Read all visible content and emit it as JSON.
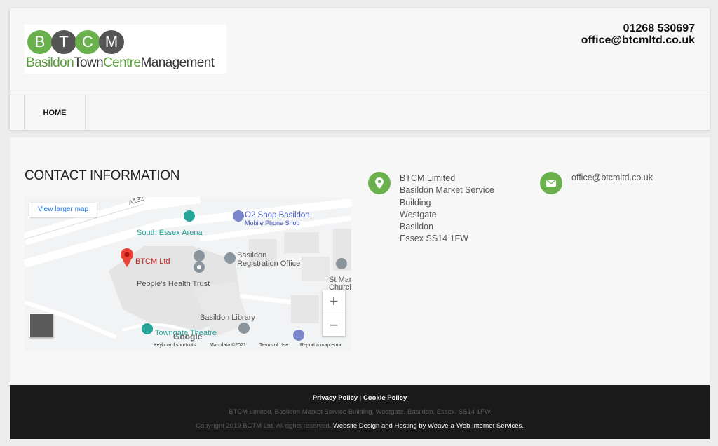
{
  "header": {
    "logo": {
      "letters": [
        "B",
        "T",
        "C",
        "M"
      ],
      "name_part1": "Basildon",
      "name_part2": "Town",
      "name_part3": "Centre",
      "name_part4": "Management"
    },
    "phone": "01268 530697",
    "email": "office@btcmltd.co.uk"
  },
  "nav": {
    "items": [
      {
        "label": "HOME"
      }
    ]
  },
  "main": {
    "title": "CONTACT INFORMATION",
    "address_lines": [
      "BTCM Limited",
      "Basildon Market Service",
      "Building",
      "Westgate",
      "Basildon",
      "Essex SS14 1FW"
    ],
    "email": "office@btcmltd.co.uk"
  },
  "map": {
    "view_larger": "View larger map",
    "road_label": "A132",
    "pins": {
      "btcm": "BTCM Ltd",
      "o2_shop": "O2 Shop Basildon",
      "o2_sub": "Mobile Phone Shop",
      "arena": "South Essex Arena",
      "registration_1": "Basildon",
      "registration_2": "Registration Office",
      "peoples_health": "People's Health Trust",
      "library": "Basildon Library",
      "theatre": "Towngate Theatre",
      "church_1": "St Mar",
      "church_2": "Church"
    },
    "google": "Google",
    "zoom_in": "+",
    "zoom_out": "−",
    "footer": {
      "shortcuts": "Keyboard shortcuts",
      "map_data": "Map data ©2021",
      "terms": "Terms of Use",
      "report": "Report a map error"
    }
  },
  "footer": {
    "privacy": "Privacy Policy",
    "separator": "|",
    "cookie": "Cookie Policy",
    "address": "BTCM Limited, Basildon Market Service Building, Westgate, Basildon, Essex. SS14 1FW",
    "copyright": "Copyright 2019 BCTM Ltd. All rights reserved.",
    "credit": "Website Design and Hosting by Weave-a-Web Internet Services."
  },
  "colors": {
    "accent_green": "#6ab04c",
    "logo_dark_circle": "#555555",
    "footer_bg": "#1a1a1a",
    "map_pin_red": "#ea4335",
    "map_teal": "#26a69a"
  }
}
